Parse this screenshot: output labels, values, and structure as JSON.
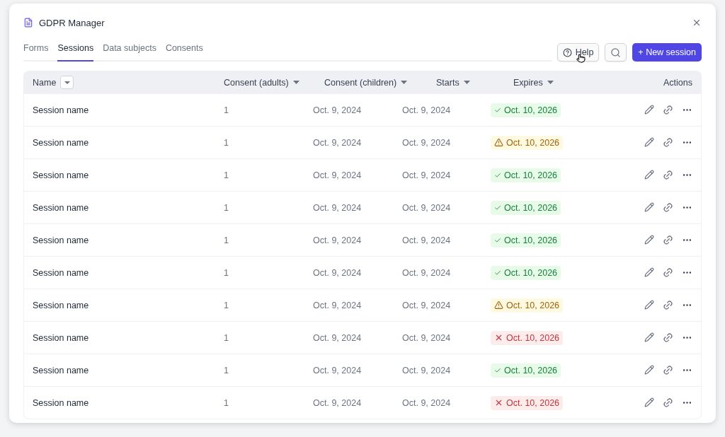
{
  "window": {
    "title": "GDPR Manager"
  },
  "tabs": [
    {
      "label": "Forms",
      "selected": false
    },
    {
      "label": "Sessions",
      "selected": true
    },
    {
      "label": "Data subjects",
      "selected": false
    },
    {
      "label": "Consents",
      "selected": false
    }
  ],
  "toolbar": {
    "help": "Help",
    "new_session": "+ New session"
  },
  "table": {
    "columns": [
      "Name",
      "Consent (adults)",
      "Consent (children)",
      "Starts",
      "Expires",
      "Actions"
    ],
    "rows": [
      {
        "name": "Session name",
        "adults": "1",
        "starts_children": "Oct. 9, 2024",
        "starts": "Oct. 9, 2024",
        "expires": {
          "kind": "ok",
          "text": "Oct. 10, 2026"
        }
      },
      {
        "name": "Session name",
        "adults": "1",
        "starts_children": "Oct. 9, 2024",
        "starts": "Oct. 9, 2024",
        "expires": {
          "kind": "warning",
          "text": "Oct. 10, 2026"
        }
      },
      {
        "name": "Session name",
        "adults": "1",
        "starts_children": "Oct. 9, 2024",
        "starts": "Oct. 9, 2024",
        "expires": {
          "kind": "ok",
          "text": "Oct. 10, 2026"
        }
      },
      {
        "name": "Session name",
        "adults": "1",
        "starts_children": "Oct. 9, 2024",
        "starts": "Oct. 9, 2024",
        "expires": {
          "kind": "ok",
          "text": "Oct. 10, 2026"
        }
      },
      {
        "name": "Session name",
        "adults": "1",
        "starts_children": "Oct. 9, 2024",
        "starts": "Oct. 9, 2024",
        "expires": {
          "kind": "ok",
          "text": "Oct. 10, 2026"
        }
      },
      {
        "name": "Session name",
        "adults": "1",
        "starts_children": "Oct. 9, 2024",
        "starts": "Oct. 9, 2024",
        "expires": {
          "kind": "ok",
          "text": "Oct. 10, 2026"
        }
      },
      {
        "name": "Session name",
        "adults": "1",
        "starts_children": "Oct. 9, 2024",
        "starts": "Oct. 9, 2024",
        "expires": {
          "kind": "warning",
          "text": "Oct. 10, 2026"
        }
      },
      {
        "name": "Session name",
        "adults": "1",
        "starts_children": "Oct. 9, 2024",
        "starts": "Oct. 9, 2024",
        "expires": {
          "kind": "expired",
          "text": "Oct. 10, 2026"
        }
      },
      {
        "name": "Session name",
        "adults": "1",
        "starts_children": "Oct. 9, 2024",
        "starts": "Oct. 9, 2024",
        "expires": {
          "kind": "ok",
          "text": "Oct. 10, 2026"
        }
      },
      {
        "name": "Session name",
        "adults": "1",
        "starts_children": "Oct. 9, 2024",
        "starts": "Oct. 9, 2024",
        "expires": {
          "kind": "expired",
          "text": "Oct. 10, 2026"
        }
      }
    ]
  }
}
